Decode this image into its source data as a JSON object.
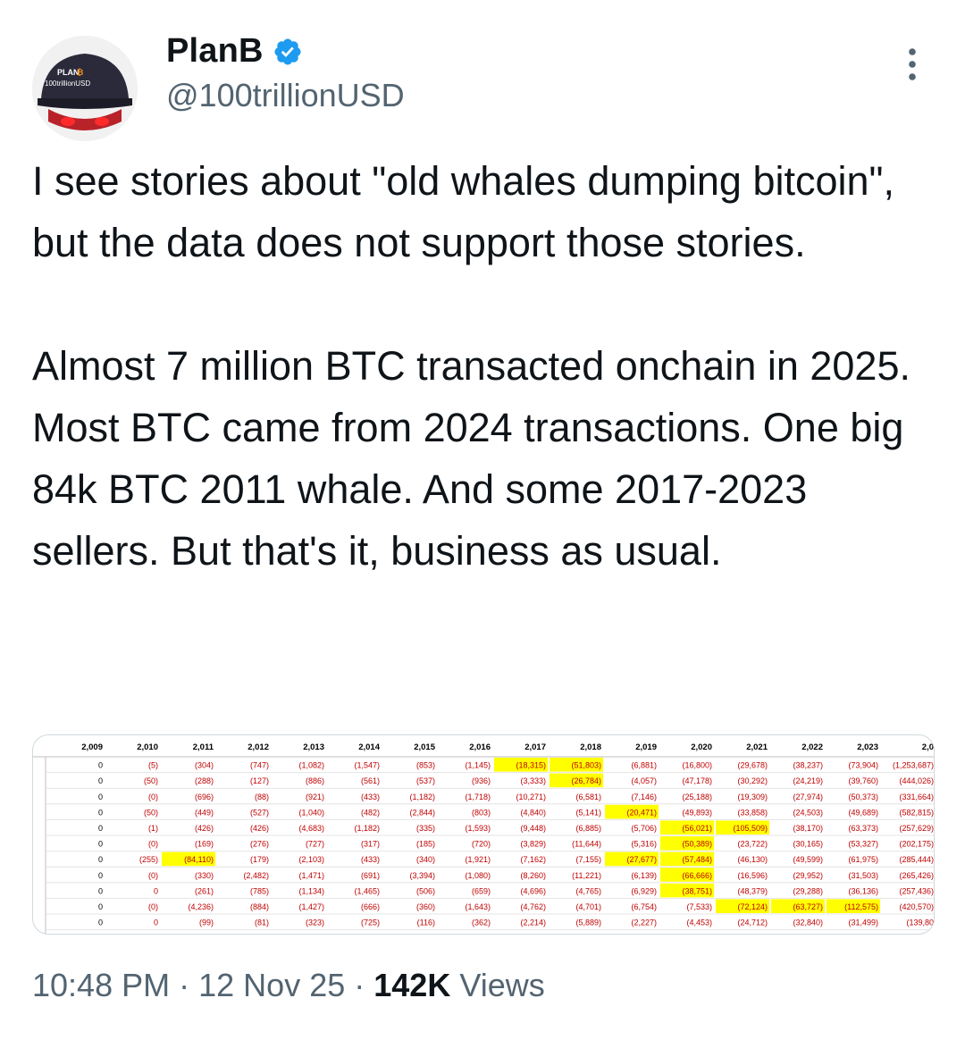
{
  "tweet": {
    "author_name": "PlanB",
    "handle": "@100trillionUSD",
    "avatar_text": [
      "PLAN",
      "100trillionUSD"
    ],
    "paragraphs": [
      "I see stories about \"old whales dumping bitcoin\", but the data does not support those stories.",
      "Almost 7 million BTC transacted onchain in 2025. Most BTC came from 2024 transactions. One big 84k BTC 2011 whale. And some 2017-2023 sellers. But that's it, business as usual."
    ],
    "time": "10:48 PM",
    "separator": "·",
    "date": "12 Nov 25",
    "views_count": "142K",
    "views_label": "Views"
  },
  "icons": {
    "verified": "verified-badge-icon",
    "more": "more-options-icon"
  },
  "colors": {
    "verified_blue": "#1d9bf0",
    "highlight_yellow": "#ffff00",
    "cell_red": "#c00000",
    "secondary_text": "#536471"
  },
  "table": {
    "headers": [
      "2,009",
      "2,010",
      "2,011",
      "2,012",
      "2,013",
      "2,014",
      "2,015",
      "2,016",
      "2,017",
      "2,018",
      "2,019",
      "2,020",
      "2,021",
      "2,022",
      "2,023",
      "2,0"
    ],
    "rows": [
      [
        "0",
        "(5)",
        "(304)",
        "(747)",
        "(1,082)",
        "(1,547)",
        "(853)",
        "(1,145)",
        "(18,315)",
        "(51,803)",
        "(6,881)",
        "(16,800)",
        "(29,678)",
        "(38,237)",
        "(73,904)",
        "(1,253,687)"
      ],
      [
        "0",
        "(50)",
        "(288)",
        "(127)",
        "(886)",
        "(561)",
        "(537)",
        "(936)",
        "(3,333)",
        "(26,784)",
        "(4,057)",
        "(47,178)",
        "(30,292)",
        "(24,219)",
        "(39,760)",
        "(444,026)"
      ],
      [
        "0",
        "(0)",
        "(696)",
        "(88)",
        "(921)",
        "(433)",
        "(1,182)",
        "(1,718)",
        "(10,271)",
        "(6,581)",
        "(7,146)",
        "(25,188)",
        "(19,309)",
        "(27,974)",
        "(50,373)",
        "(331,664)"
      ],
      [
        "0",
        "(50)",
        "(449)",
        "(527)",
        "(1,040)",
        "(482)",
        "(2,844)",
        "(803)",
        "(4,840)",
        "(5,141)",
        "(20,471)",
        "(49,893)",
        "(33,858)",
        "(24,503)",
        "(49,689)",
        "(582,815)"
      ],
      [
        "0",
        "(1)",
        "(426)",
        "(426)",
        "(4,683)",
        "(1,182)",
        "(335)",
        "(1,593)",
        "(9,448)",
        "(6,885)",
        "(5,706)",
        "(56,021)",
        "(105,509)",
        "(38,170)",
        "(63,373)",
        "(257,629)"
      ],
      [
        "0",
        "(0)",
        "(169)",
        "(276)",
        "(727)",
        "(317)",
        "(185)",
        "(720)",
        "(3,829)",
        "(11,644)",
        "(5,316)",
        "(50,389)",
        "(23,722)",
        "(30,165)",
        "(53,327)",
        "(202,175)"
      ],
      [
        "0",
        "(255)",
        "(84,110)",
        "(179)",
        "(2,103)",
        "(433)",
        "(340)",
        "(1,921)",
        "(7,162)",
        "(7,155)",
        "(27,677)",
        "(57,484)",
        "(46,130)",
        "(49,599)",
        "(61,975)",
        "(285,444)"
      ],
      [
        "0",
        "(0)",
        "(330)",
        "(2,482)",
        "(1,471)",
        "(691)",
        "(3,394)",
        "(1,080)",
        "(8,260)",
        "(11,221)",
        "(6,139)",
        "(66,666)",
        "(16,596)",
        "(29,952)",
        "(31,503)",
        "(265,426)"
      ],
      [
        "0",
        "0",
        "(261)",
        "(785)",
        "(1,134)",
        "(1,465)",
        "(506)",
        "(659)",
        "(4,696)",
        "(4,765)",
        "(6,929)",
        "(38,751)",
        "(48,379)",
        "(29,288)",
        "(36,136)",
        "(257,436)"
      ],
      [
        "0",
        "(0)",
        "(4,236)",
        "(884)",
        "(1,427)",
        "(666)",
        "(360)",
        "(1,643)",
        "(4,762)",
        "(4,701)",
        "(6,754)",
        "(7,533)",
        "(72,124)",
        "(63,727)",
        "(112,575)",
        "(420,570)"
      ],
      [
        "0",
        "0",
        "(99)",
        "(81)",
        "(323)",
        "(725)",
        "(116)",
        "(362)",
        "(2,214)",
        "(5,889)",
        "(2,227)",
        "(4,453)",
        "(24,712)",
        "(32,840)",
        "(31,499)",
        "(139,80"
      ]
    ],
    "highlighted_cells": [
      [
        0,
        8
      ],
      [
        0,
        9
      ],
      [
        1,
        9
      ],
      [
        3,
        10
      ],
      [
        4,
        11
      ],
      [
        4,
        12
      ],
      [
        5,
        11
      ],
      [
        6,
        2
      ],
      [
        6,
        10
      ],
      [
        6,
        11
      ],
      [
        7,
        11
      ],
      [
        8,
        11
      ],
      [
        9,
        12
      ],
      [
        9,
        13
      ],
      [
        9,
        14
      ]
    ]
  }
}
